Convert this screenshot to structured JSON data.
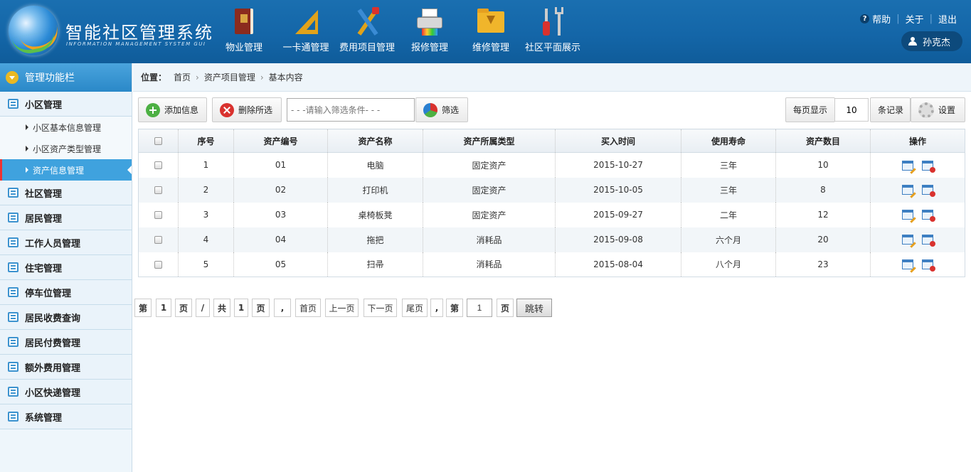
{
  "header": {
    "title": "智能社区管理系统",
    "subtitle": "INFORMATION MANAGEMENT SYSTEM GUI",
    "nav": [
      {
        "label": "物业管理",
        "icon": "book-icon"
      },
      {
        "label": "一卡通管理",
        "icon": "ruler-icon"
      },
      {
        "label": "费用项目管理",
        "icon": "tools-icon"
      },
      {
        "label": "报修管理",
        "icon": "printer-icon"
      },
      {
        "label": "维修管理",
        "icon": "folder-download-icon"
      },
      {
        "label": "社区平面展示",
        "icon": "screwdriver-wrench-icon"
      }
    ],
    "help": "帮助",
    "about": "关于",
    "logout": "退出",
    "user": "孙克杰"
  },
  "sidebar": {
    "title": "管理功能栏",
    "group_title": "小区管理",
    "subitems": [
      "小区基本信息管理",
      "小区资产类型管理",
      "资产信息管理"
    ],
    "active_index": 2,
    "items": [
      "社区管理",
      "居民管理",
      "工作人员管理",
      "住宅管理",
      "停车位管理",
      "居民收费查询",
      "居民付费管理",
      "额外费用管理",
      "小区快递管理",
      "系统管理"
    ]
  },
  "breadcrumb": {
    "label": "位置：",
    "items": [
      "首页",
      "资产项目管理",
      "基本内容"
    ]
  },
  "toolbar": {
    "add": "添加信息",
    "delete": "删除所选",
    "filter_placeholder": "- - -请输入筛选条件- - -",
    "filter": "筛选",
    "per_page_label": "每页显示",
    "per_page_value": "10",
    "records_label": "条记录",
    "settings": "设置"
  },
  "table": {
    "headers": [
      "序号",
      "资产编号",
      "资产名称",
      "资产所属类型",
      "买入时间",
      "使用寿命",
      "资产数目",
      "操作"
    ],
    "rows": [
      [
        "1",
        "01",
        "电脑",
        "固定资产",
        "2015-10-27",
        "三年",
        "10"
      ],
      [
        "2",
        "02",
        "打印机",
        "固定资产",
        "2015-10-05",
        "三年",
        "8"
      ],
      [
        "3",
        "03",
        "桌椅板凳",
        "固定资产",
        "2015-09-27",
        "二年",
        "12"
      ],
      [
        "4",
        "04",
        "拖把",
        "消耗品",
        "2015-09-08",
        "六个月",
        "20"
      ],
      [
        "5",
        "05",
        "扫帚",
        "消耗品",
        "2015-08-04",
        "八个月",
        "23"
      ]
    ]
  },
  "pager": {
    "di": "第",
    "cur": "1",
    "ye": "页",
    "slash": "/",
    "gong": "共",
    "total": "1",
    "ye2": "页",
    "comma": ",",
    "first": "首页",
    "prev": "上一页",
    "next": "下一页",
    "last": "尾页",
    "comma2": ",",
    "di2": "第",
    "jump_value": "1",
    "ye3": "页",
    "go": "跳转"
  }
}
